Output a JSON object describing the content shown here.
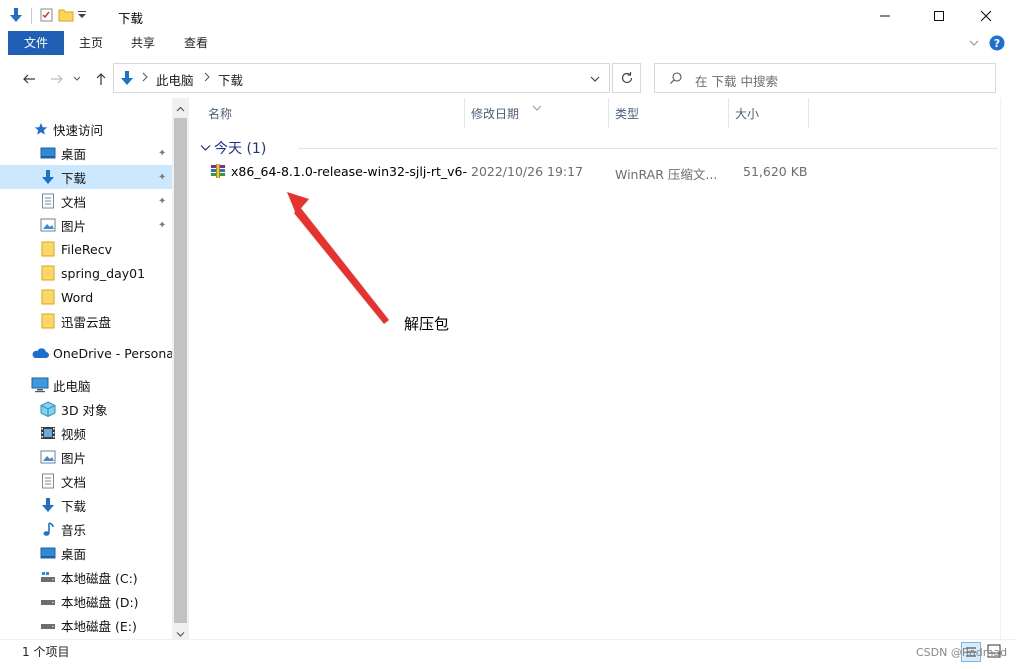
{
  "window": {
    "title": "下载",
    "controls": [
      "minimize",
      "maximize",
      "close"
    ]
  },
  "ribbon": {
    "tabs": [
      "文件",
      "主页",
      "共享",
      "查看"
    ]
  },
  "address": {
    "crumbs": [
      "此电脑",
      "下载"
    ],
    "search_placeholder": "在 下载 中搜索"
  },
  "nav": {
    "quick_access": "快速访问",
    "pinned": [
      {
        "label": "桌面",
        "icon": "desktop-icon"
      },
      {
        "label": "下载",
        "icon": "download-icon",
        "selected": true
      },
      {
        "label": "文档",
        "icon": "document-icon"
      },
      {
        "label": "图片",
        "icon": "picture-icon"
      }
    ],
    "folders": [
      "FileRecv",
      "spring_day01",
      "Word",
      "迅雷云盘"
    ],
    "onedrive": "OneDrive - Personal",
    "this_pc": "此电脑",
    "pc_items": [
      {
        "label": "3D 对象",
        "icon": "3d-objects-icon"
      },
      {
        "label": "视频",
        "icon": "video-icon"
      },
      {
        "label": "图片",
        "icon": "picture-icon"
      },
      {
        "label": "文档",
        "icon": "document-icon"
      },
      {
        "label": "下载",
        "icon": "download-icon"
      },
      {
        "label": "音乐",
        "icon": "music-icon"
      },
      {
        "label": "桌面",
        "icon": "desktop-icon"
      },
      {
        "label": "本地磁盘 (C:)",
        "icon": "drive-c-icon"
      },
      {
        "label": "本地磁盘 (D:)",
        "icon": "drive-icon"
      },
      {
        "label": "本地磁盘 (E:)",
        "icon": "drive-icon"
      }
    ]
  },
  "columns": {
    "name": "名称",
    "date": "修改日期",
    "type": "类型",
    "size": "大小"
  },
  "group": {
    "title": "今天 (1)"
  },
  "files": [
    {
      "name": "x86_64-8.1.0-release-win32-sjlj-rt_v6-...",
      "date": "2022/10/26 19:17",
      "type": "WinRAR 压缩文...",
      "size": "51,620 KB",
      "icon": "winrar-archive-icon"
    }
  ],
  "annotation": {
    "text": "解压包",
    "color": "#e8322f"
  },
  "status": {
    "count": "1 个项目",
    "watermark": "CSDN @Rodmad"
  },
  "colors": {
    "accent": "#1f5fb6",
    "selection": "#cce8ff",
    "group_title": "#1e3287",
    "arrow": "#e8322f"
  }
}
